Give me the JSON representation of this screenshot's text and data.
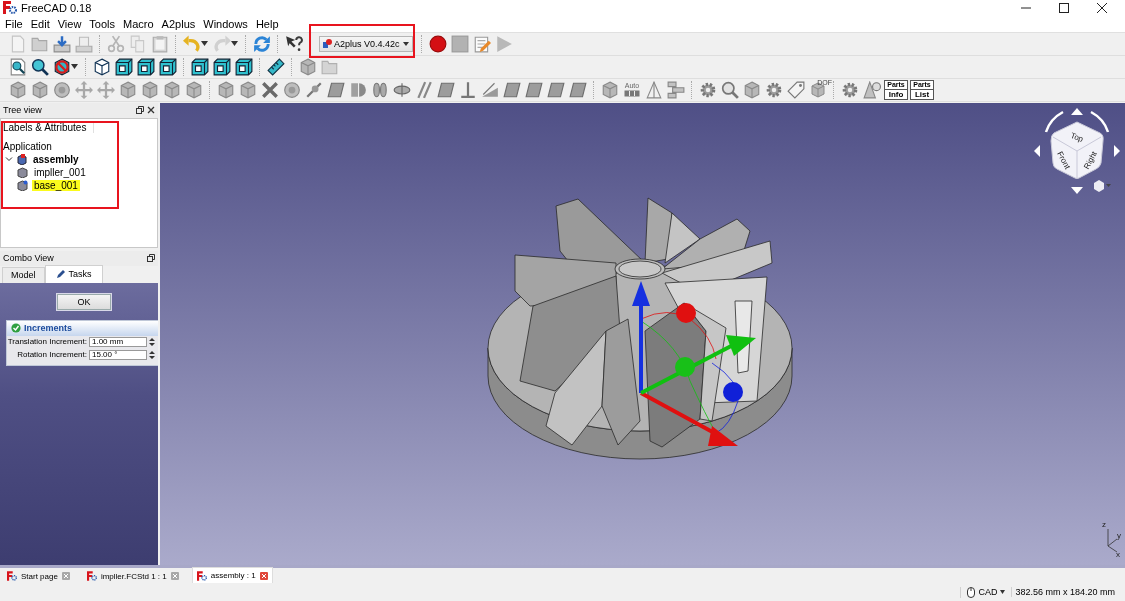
{
  "window": {
    "title": "FreeCAD 0.18"
  },
  "menu": [
    "File",
    "Edit",
    "View",
    "Tools",
    "Macro",
    "A2plus",
    "Windows",
    "Help"
  ],
  "toolbar": {
    "workbench": {
      "value": "A2plus V0.4.42c",
      "annotated": true
    },
    "labeled_icons": [
      {
        "kind": "auto",
        "lines": [
          "Auto"
        ]
      },
      {
        "kind": "dof",
        "lines": [
          "DOF"
        ]
      },
      {
        "kind": "parts",
        "lines": [
          "Parts",
          "Info"
        ]
      },
      {
        "kind": "parts",
        "lines": [
          "Parts",
          "List"
        ]
      }
    ]
  },
  "tree_view": {
    "title": "Tree view",
    "header": "Labels & Attributes",
    "root": "Application",
    "annotated": true,
    "items": [
      {
        "label": "assembly",
        "expanded": true,
        "selected": false,
        "children": [
          {
            "label": "impller_001",
            "selected": false
          },
          {
            "label": "base_001",
            "selected": true
          }
        ]
      }
    ]
  },
  "combo_view": {
    "title": "Combo View",
    "tabs": [
      {
        "label": "Model",
        "selected": false
      },
      {
        "label": "Tasks",
        "selected": true
      }
    ],
    "ok_button": "OK",
    "panel": {
      "title": "Increments",
      "fields": [
        {
          "label": "Translation Increment:",
          "value": "1.00 mm"
        },
        {
          "label": "Rotation Increment:",
          "value": "15.00 °"
        }
      ]
    }
  },
  "viewport": {
    "nav_cube": {
      "faces": [
        "Top",
        "Front",
        "Right"
      ]
    },
    "axis_labels": [
      "z",
      "y",
      "x"
    ]
  },
  "document_tabs": [
    {
      "label": "Start page",
      "selected": false
    },
    {
      "label": "impller.FCStd 1 : 1",
      "selected": false
    },
    {
      "label": "assembly : 1",
      "selected": true
    }
  ],
  "status_bar": {
    "navigation": "CAD",
    "dimensions": "382.56 mm x 184.20 mm"
  }
}
